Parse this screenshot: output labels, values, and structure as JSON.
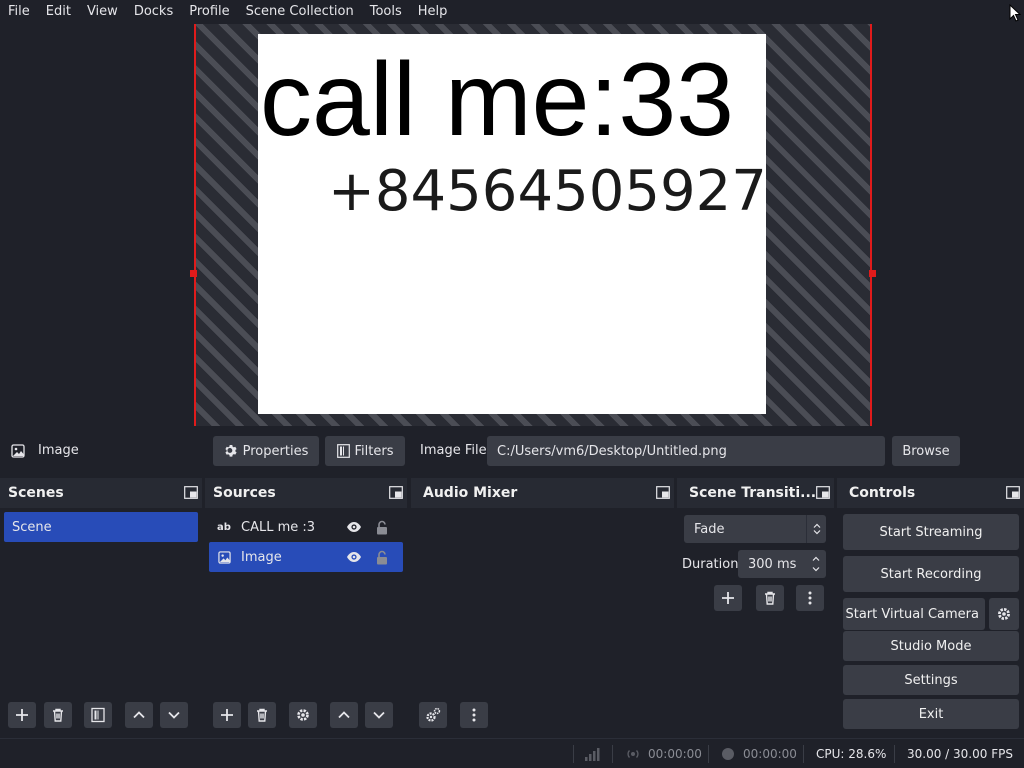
{
  "menu": [
    "File",
    "Edit",
    "View",
    "Docks",
    "Profile",
    "Scene Collection",
    "Tools",
    "Help"
  ],
  "preview": {
    "text_line1": "call me:33",
    "text_line2": "+84564505927"
  },
  "source_toolbar": {
    "source_name": "Image",
    "properties_label": "Properties",
    "filters_label": "Filters",
    "image_file_label": "Image File",
    "image_file_value": "C:/Users/vm6/Desktop/Untitled.png",
    "browse_label": "Browse"
  },
  "scenes": {
    "title": "Scenes",
    "items": [
      {
        "label": "Scene",
        "selected": true
      }
    ]
  },
  "sources": {
    "title": "Sources",
    "items": [
      {
        "label": "CALL me :3",
        "icon": "text-source-icon",
        "icon_text": "ab",
        "selected": false
      },
      {
        "label": "Image",
        "icon": "image-source-icon",
        "selected": true
      }
    ]
  },
  "audio_mixer": {
    "title": "Audio Mixer"
  },
  "transitions": {
    "title": "Scene Transiti...",
    "selected": "Fade",
    "duration_label": "Duration",
    "duration_value": "300 ms"
  },
  "controls": {
    "title": "Controls",
    "start_streaming": "Start Streaming",
    "start_recording": "Start Recording",
    "start_virtual_camera": "Start Virtual Camera",
    "studio_mode": "Studio Mode",
    "settings": "Settings",
    "exit": "Exit"
  },
  "status": {
    "stream_time": "00:00:00",
    "record_time": "00:00:00",
    "cpu": "CPU: 28.6%",
    "fps": "30.00 / 30.00 FPS"
  },
  "colors": {
    "background": "#1f2129",
    "panel": "#2b2e38",
    "button": "#3a3d46",
    "selection": "#284cb8",
    "bounding_box": "#e01b1b"
  }
}
